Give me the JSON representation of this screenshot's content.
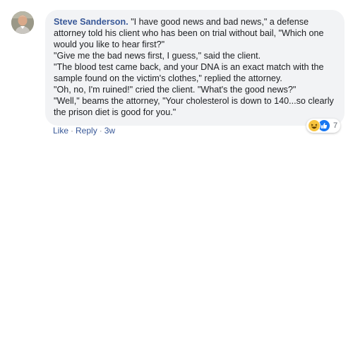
{
  "comment": {
    "author": "Steve Sanderson.",
    "lines": [
      " \"I have good news and bad news,\" a defense",
      "attorney told his client who has been on trial without bail, \"Which one",
      "would you like to hear first?\"",
      "\"Give me the bad news first, I guess,\" said the client.",
      "\"The blood test came back, and your DNA is an exact match with the",
      "sample found on the victim's clothes,\" replied the attorney.",
      "\"Oh, no, I'm ruined!\" cried the client. \"What's the good news?\"",
      "\"Well,\" beams the attorney, \"Your cholesterol is down to 140...so clearly",
      "the prison diet is good for you.\""
    ]
  },
  "actions": {
    "like_label": "Like",
    "reply_label": "Reply",
    "separator": "·",
    "time": "3w"
  },
  "reactions": {
    "icons": [
      "haha-icon",
      "like-icon"
    ],
    "count": "7"
  },
  "colors": {
    "author": "#385898",
    "bubble": "#f2f3f5",
    "like_reaction": "#1877f2",
    "haha_reaction": "#f7c43f"
  }
}
